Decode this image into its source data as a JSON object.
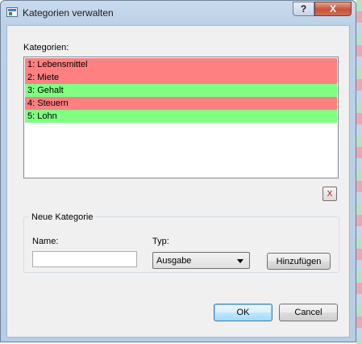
{
  "window": {
    "title": "Kategorien verwalten",
    "help_glyph": "?",
    "close_glyph": "X"
  },
  "categories_label": "Kategorien:",
  "categories": [
    {
      "label": "1: Lebensmittel",
      "kind": "expense",
      "color": "#ff8080"
    },
    {
      "label": "2: Miete",
      "kind": "expense",
      "color": "#ff8080"
    },
    {
      "label": "3: Gehalt",
      "kind": "income",
      "color": "#80ff80"
    },
    {
      "label": "4: Steuern",
      "kind": "expense",
      "color": "#ff8080"
    },
    {
      "label": "5: Lohn",
      "kind": "income",
      "color": "#80ff80"
    }
  ],
  "delete_button": {
    "label": "X",
    "icon": "delete-icon",
    "color": "#d00000"
  },
  "new_category": {
    "group_title": "Neue Kategorie",
    "name_label": "Name:",
    "name_value": "",
    "type_label": "Typ:",
    "type_selected": "Ausgabe",
    "add_label": "Hinzufügen"
  },
  "footer": {
    "ok_label": "OK",
    "cancel_label": "Cancel"
  }
}
